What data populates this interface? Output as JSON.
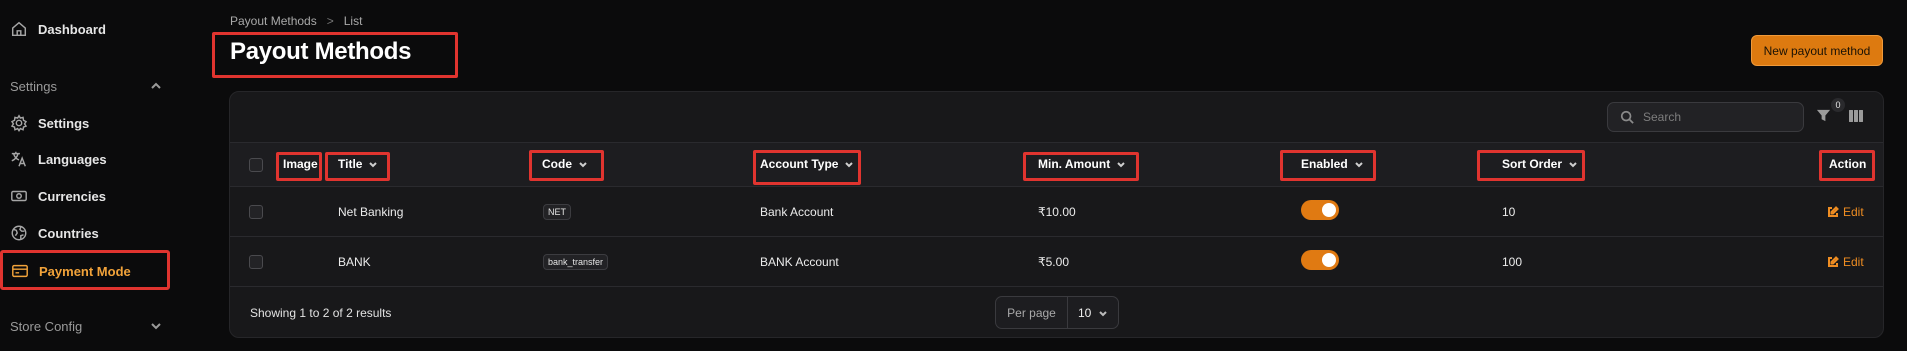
{
  "sidebar": {
    "dashboard": "Dashboard",
    "settings_group": "Settings",
    "settings": "Settings",
    "languages": "Languages",
    "currencies": "Currencies",
    "countries": "Countries",
    "payment_mode": "Payment Mode",
    "store_config_group": "Store Config"
  },
  "breadcrumb": {
    "parent": "Payout Methods",
    "separator": ">",
    "current": "List"
  },
  "page_title": "Payout Methods",
  "new_button": "New payout method",
  "search": {
    "placeholder": "Search"
  },
  "filter_count": "0",
  "table": {
    "headers": {
      "image": "Image",
      "title": "Title",
      "code": "Code",
      "account_type": "Account Type",
      "min_amount": "Min. Amount",
      "enabled": "Enabled",
      "sort_order": "Sort Order",
      "action": "Action"
    },
    "rows": [
      {
        "title": "Net Banking",
        "code": "NET",
        "account_type": "Bank Account",
        "min_amount": "₹10.00",
        "enabled": true,
        "sort_order": "10",
        "action": "Edit"
      },
      {
        "title": "BANK",
        "code": "bank_transfer",
        "account_type": "BANK Account",
        "min_amount": "₹5.00",
        "enabled": true,
        "sort_order": "100",
        "action": "Edit"
      }
    ]
  },
  "footer": {
    "showing": "Showing 1 to 2 of 2 results",
    "per_page_label": "Per page",
    "per_page_value": "10"
  },
  "colors": {
    "accent": "#dd7a10",
    "highlight": "#e0342f",
    "background": "#0b0b0c"
  }
}
